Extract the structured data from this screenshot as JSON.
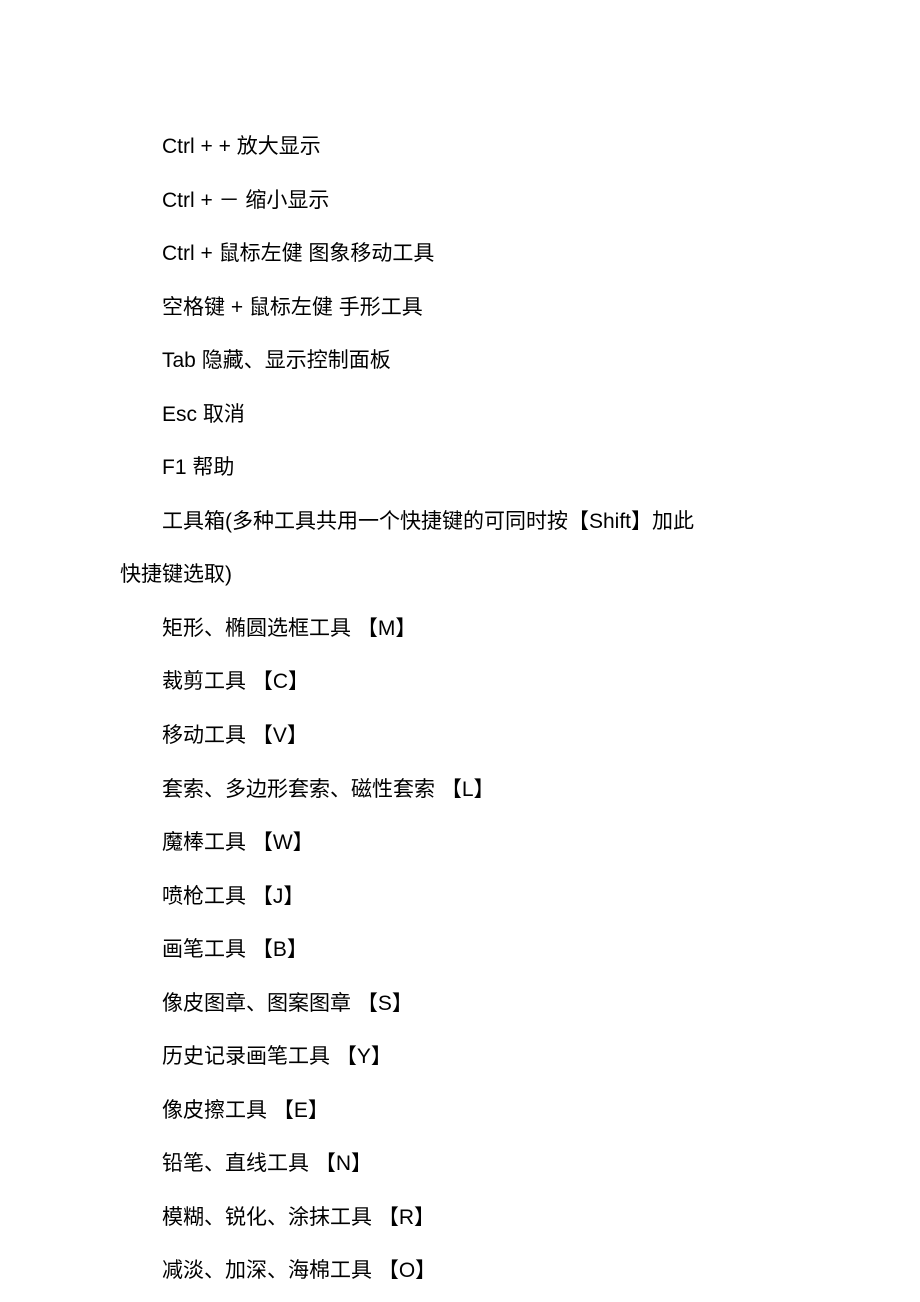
{
  "lines": [
    "Ctrl + + 放大显示",
    "Ctrl + － 缩小显示",
    "Ctrl + 鼠标左健 图象移动工具",
    "空格键 + 鼠标左健 手形工具",
    "Tab 隐藏、显示控制面板",
    "Esc 取消",
    "F1 帮助",
    "工具箱(多种工具共用一个快捷键的可同时按【Shift】加此",
    "矩形、椭圆选框工具 【M】",
    "裁剪工具 【C】",
    "移动工具 【V】",
    "套索、多边形套索、磁性套索 【L】",
    "魔棒工具 【W】",
    "喷枪工具 【J】",
    "画笔工具 【B】",
    "像皮图章、图案图章 【S】",
    "历史记录画笔工具 【Y】",
    "像皮擦工具 【E】",
    "铅笔、直线工具 【N】",
    "模糊、锐化、涂抹工具 【R】",
    "减淡、加深、海棉工具 【O】"
  ],
  "wrapline": "快捷键选取)"
}
